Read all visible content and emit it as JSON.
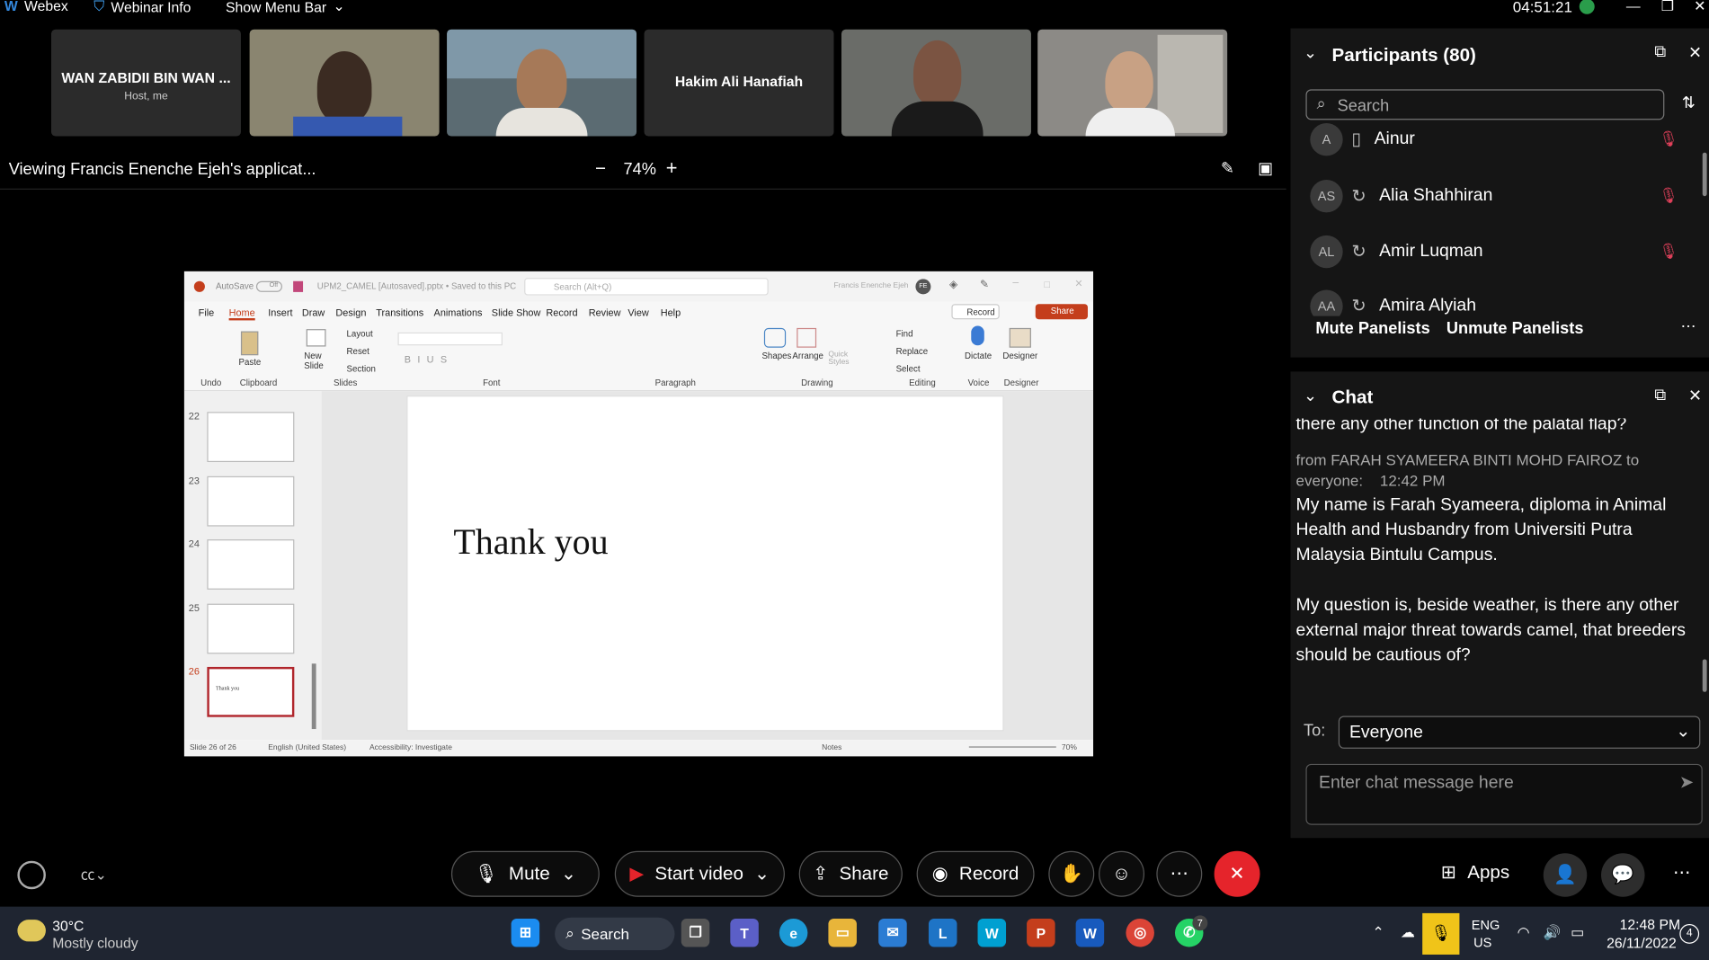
{
  "topbar": {
    "app_name": "Webex",
    "webinar_info": "Webinar Info",
    "show_menu_bar": "Show Menu Bar",
    "time": "04:51:21"
  },
  "video_strip": [
    {
      "name": "WAN ZABIDII BIN WAN ...",
      "sub": "Host, me"
    },
    {
      "name": "",
      "sub": ""
    },
    {
      "name": "",
      "sub": ""
    },
    {
      "name": "Hakim Ali Hanafiah",
      "sub": ""
    },
    {
      "name": "",
      "sub": ""
    },
    {
      "name": "",
      "sub": ""
    }
  ],
  "viewbar": {
    "viewing_text": "Viewing Francis Enenche Ejeh's applicat...",
    "zoom": "74%",
    "zoom_minus": "−",
    "zoom_plus": "+"
  },
  "ppt": {
    "autosave": "AutoSave",
    "off": "Off",
    "filename": "UPM2_CAMEL [Autosaved].pptx • Saved to this PC",
    "search": "Search (Alt+Q)",
    "user": "Francis Enenche Ejeh",
    "initials": "FE",
    "tabs": [
      "File",
      "Home",
      "Insert",
      "Draw",
      "Design",
      "Transitions",
      "Animations",
      "Slide Show",
      "Record",
      "Review",
      "View",
      "Help"
    ],
    "record_btn": "Record",
    "share_btn": "Share",
    "groups": [
      "Undo",
      "Clipboard",
      "Slides",
      "Font",
      "Paragraph",
      "Drawing",
      "Editing",
      "Voice",
      "Designer"
    ],
    "ribbon_labels": {
      "paste": "Paste",
      "new_slide": "New Slide",
      "layout": "Layout",
      "reset": "Reset",
      "section": "Section",
      "shapes": "Shapes",
      "arrange": "Arrange",
      "quick_styles": "Quick Styles",
      "find": "Find",
      "replace": "Replace",
      "select": "Select",
      "dictate": "Dictate",
      "designer": "Designer"
    },
    "slide_numbers": [
      "22",
      "23",
      "24",
      "25",
      "26"
    ],
    "current_slide_text": "Thank you",
    "thumb_26_text": "Thank you",
    "status": {
      "slide_of": "Slide 26 of 26",
      "language": "English (United States)",
      "accessibility": "Accessibility: Investigate",
      "notes": "Notes",
      "zoom": "70%"
    }
  },
  "participants": {
    "title": "Participants (80)",
    "search_placeholder": "Search",
    "list": [
      {
        "initials": "A",
        "name": "Ainur"
      },
      {
        "initials": "AS",
        "name": "Alia Shahhiran"
      },
      {
        "initials": "AL",
        "name": "Amir Luqman"
      },
      {
        "initials": "AA",
        "name": "Amira Alyiah"
      }
    ],
    "mute_panelists": "Mute Panelists",
    "unmute_panelists": "Unmute Panelists"
  },
  "chat": {
    "title": "Chat",
    "cut_line": "there any other function of the palatal flap?",
    "from_line1": "from FARAH SYAMEERA BINTI MOHD FAIROZ to",
    "from_line2": "everyone:",
    "from_time": "12:42 PM",
    "message_p1": "My name is Farah Syameera, diploma in Animal Health and Husbandry from Universiti Putra Malaysia Bintulu Campus.",
    "message_p2": "My question is, beside weather, is there any other external major threat towards camel, that breeders should be cautious of?",
    "to_label": "To:",
    "to_value": "Everyone",
    "input_placeholder": "Enter chat message here"
  },
  "controls": {
    "mute": "Mute",
    "start_video": "Start video",
    "share": "Share",
    "record": "Record",
    "apps": "Apps"
  },
  "taskbar": {
    "weather_temp": "30°C",
    "weather_desc": "Mostly cloudy",
    "search": "Search",
    "lang1": "ENG",
    "lang2": "US",
    "time": "12:48 PM",
    "date": "26/11/2022",
    "whatsapp_badge": "7",
    "notif_count": "4"
  },
  "colors": {
    "accent_red": "#e5242b",
    "ppt_red": "#c43e1c",
    "muted_red": "#e0405a",
    "win_blue": "#0078d4"
  }
}
